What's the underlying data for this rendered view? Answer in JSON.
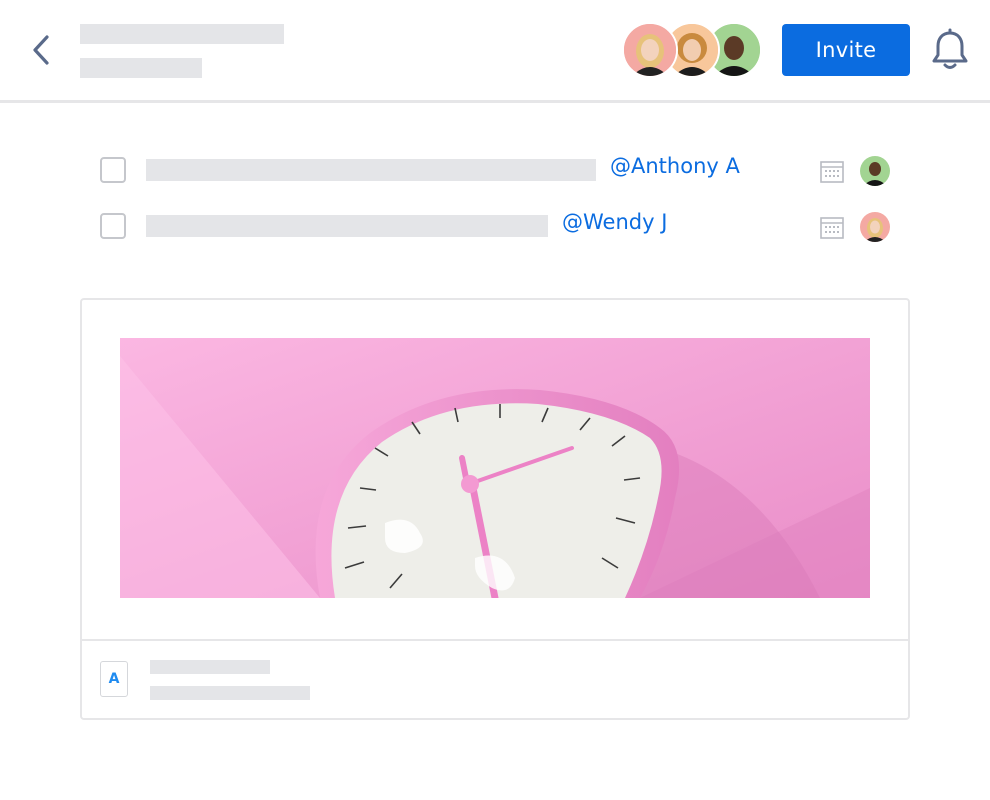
{
  "header": {
    "invite_label": "Invite",
    "collaborators": [
      "avatar-woman-blonde",
      "avatar-woman-curly",
      "avatar-man"
    ]
  },
  "tasks": [
    {
      "mention": "@Anthony A",
      "assignee_avatar": "avatar-man"
    },
    {
      "mention": "@Wendy J",
      "assignee_avatar": "avatar-woman-blonde"
    }
  ],
  "card": {
    "image": "melting-pink-clock",
    "file_icon_letter": "A"
  },
  "colors": {
    "accent": "#0b6ce0",
    "skeleton": "#e4e5e8",
    "border": "#e6e6e8",
    "pink": "#f3a2d6"
  }
}
